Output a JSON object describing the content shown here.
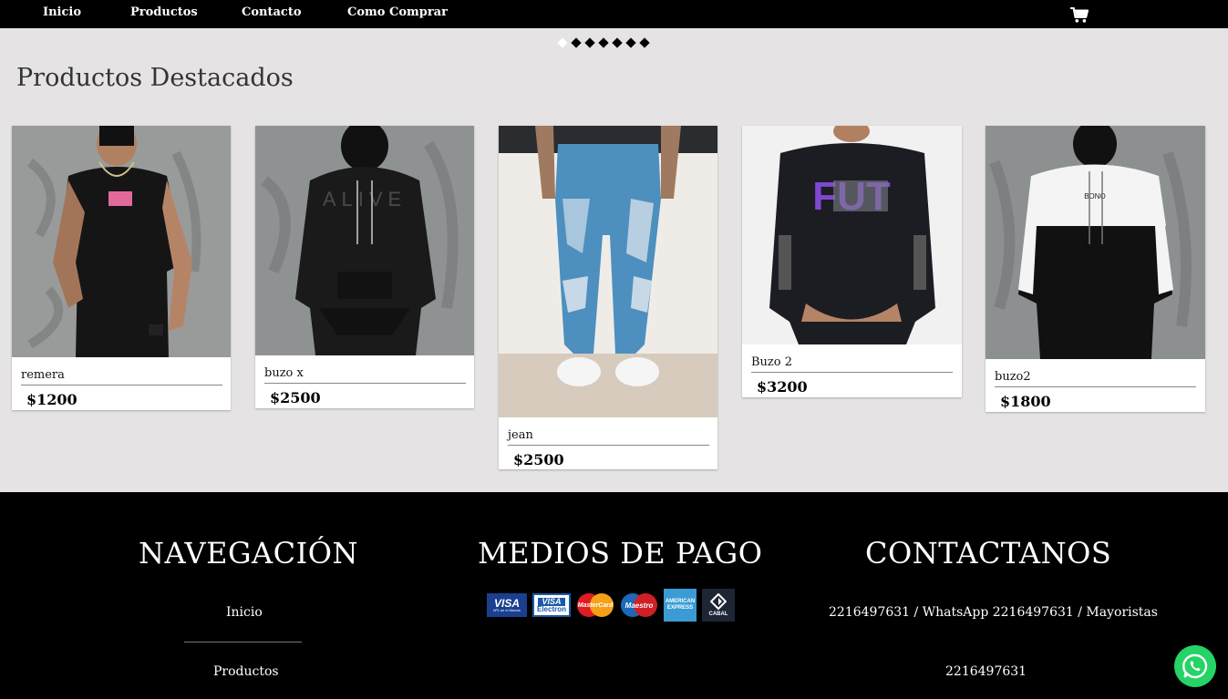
{
  "nav": {
    "items": [
      "Inicio",
      "Productos",
      "Contacto",
      "Como Comprar"
    ],
    "cart_icon": "shopping-cart-icon"
  },
  "slider": {
    "dots": 7,
    "active_index": 0
  },
  "featured": {
    "title": "Productos Destacados",
    "products": [
      {
        "name": "remera",
        "price": "$1200"
      },
      {
        "name": "buzo x",
        "price": "$2500"
      },
      {
        "name": "jean",
        "price": "$2500"
      },
      {
        "name": "Buzo 2",
        "price": "$3200"
      },
      {
        "name": "buzo2",
        "price": "$1800"
      }
    ]
  },
  "footer": {
    "nav_title": "NAVEGACIÓN",
    "nav_links": [
      "Inicio",
      "Productos"
    ],
    "payment_title": "MEDIOS DE PAGO",
    "payment_methods": [
      {
        "icon": "visa-icon",
        "label": "VISA",
        "sub": "Nº1 en el Mundo"
      },
      {
        "icon": "visa-electron-icon",
        "label": "VISA",
        "sub": "Electron"
      },
      {
        "icon": "mastercard-icon",
        "label": "MasterCard"
      },
      {
        "icon": "maestro-icon",
        "label": "Maestro"
      },
      {
        "icon": "american-express-icon",
        "label": "AMERICAN EXPRESS"
      },
      {
        "icon": "cabal-icon",
        "label": "CABAL"
      }
    ],
    "contact_title": "CONTACTANOS",
    "contact_line1": "2216497631 / WhatsApp 2216497631 / Mayoristas",
    "contact_line2": "2216497631"
  },
  "whatsapp_icon": "whatsapp-icon",
  "colors": {
    "nav_bg": "#000000",
    "page_bg": "#e5e3e4",
    "footer_bg": "#000000",
    "whatsapp": "#25d366"
  }
}
